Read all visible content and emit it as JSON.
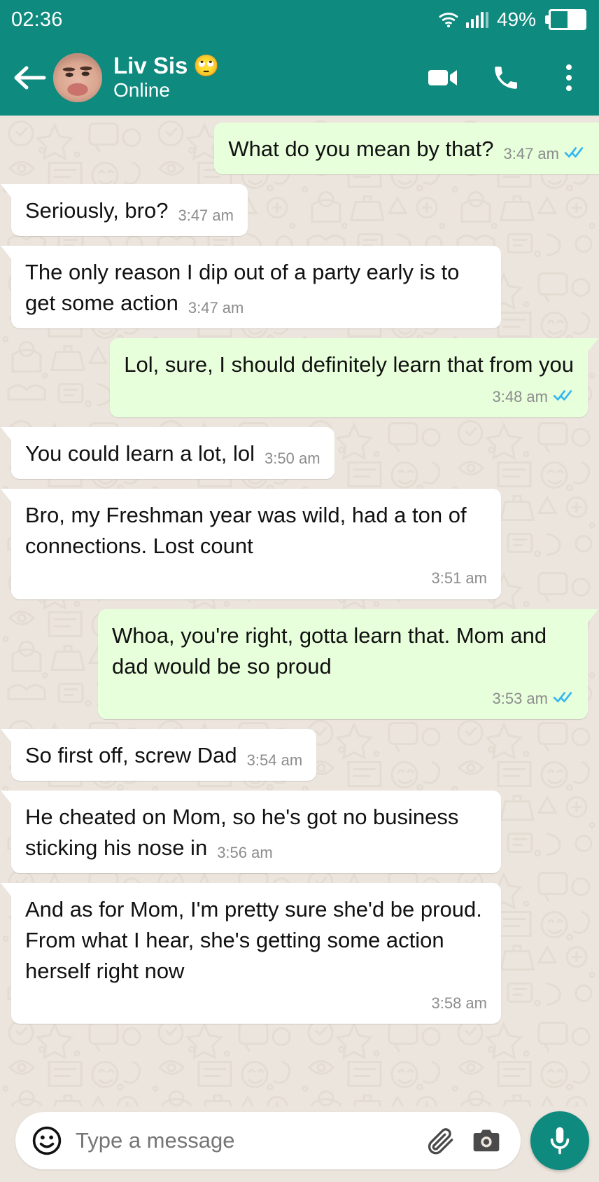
{
  "colors": {
    "header_teal": "#0F8A7E",
    "chat_background": "#ECE5DD",
    "incoming_bubble": "#FFFFFF",
    "outgoing_bubble": "#E7FFDB",
    "tick_blue": "#34B7F1",
    "timestamp_gray": "#8C8C8C",
    "placeholder_gray": "#9A9A9A"
  },
  "status_bar": {
    "time": "02:36",
    "battery_percent": "49%",
    "battery_level": 49,
    "wifi_icon": "wifi-icon",
    "signal_icon": "cellular-signal-icon",
    "battery_icon": "battery-icon"
  },
  "header": {
    "back_icon": "back-arrow-icon",
    "avatar_icon": "contact-avatar",
    "contact_name": "Liv Sis",
    "contact_name_emoji": "🙄",
    "contact_status": "Online",
    "video_call_icon": "video-call-icon",
    "voice_call_icon": "phone-call-icon",
    "menu_icon": "overflow-menu-icon"
  },
  "messages": [
    {
      "id": 1,
      "direction": "out",
      "text": "What do you mean by that?",
      "time": "3:47 am",
      "status": "read",
      "meta_inline": true,
      "clipped_right": true
    },
    {
      "id": 2,
      "direction": "in",
      "text": "Seriously, bro?",
      "time": "3:47 am",
      "status": "none",
      "meta_inline": true,
      "clipped_right": false
    },
    {
      "id": 3,
      "direction": "in",
      "text": "The only reason I dip out of a party early is to get some action",
      "time": "3:47 am",
      "status": "none",
      "meta_inline": true,
      "clipped_right": false
    },
    {
      "id": 4,
      "direction": "out",
      "text": "Lol, sure, I should definitely learn that from you",
      "time": "3:48 am",
      "status": "read",
      "meta_inline": false,
      "clipped_right": false
    },
    {
      "id": 5,
      "direction": "in",
      "text": "You could learn a lot, lol",
      "time": "3:50 am",
      "status": "none",
      "meta_inline": true,
      "clipped_right": false
    },
    {
      "id": 6,
      "direction": "in",
      "text": "Bro, my Freshman year was wild, had a ton of connections. Lost count",
      "time": "3:51 am",
      "status": "none",
      "meta_inline": false,
      "clipped_right": false
    },
    {
      "id": 7,
      "direction": "out",
      "text": "Whoa, you're right, gotta learn that. Mom and dad would be so proud",
      "time": "3:53 am",
      "status": "read",
      "meta_inline": false,
      "clipped_right": false
    },
    {
      "id": 8,
      "direction": "in",
      "text": "So first off, screw Dad",
      "time": "3:54 am",
      "status": "none",
      "meta_inline": true,
      "clipped_right": false
    },
    {
      "id": 9,
      "direction": "in",
      "text": "He cheated on Mom, so he's got no business sticking his nose in",
      "time": "3:56 am",
      "status": "none",
      "meta_inline": true,
      "clipped_right": false
    },
    {
      "id": 10,
      "direction": "in",
      "text": "And as for Mom, I'm pretty sure she'd be proud. From what I hear, she's getting some action herself right now",
      "time": "3:58 am",
      "status": "none",
      "meta_inline": false,
      "clipped_right": false
    }
  ],
  "input_bar": {
    "emoji_icon": "emoji-smiley-icon",
    "placeholder": "Type a message",
    "value": "",
    "attach_icon": "paperclip-attach-icon",
    "camera_icon": "camera-icon",
    "mic_icon": "microphone-icon"
  }
}
